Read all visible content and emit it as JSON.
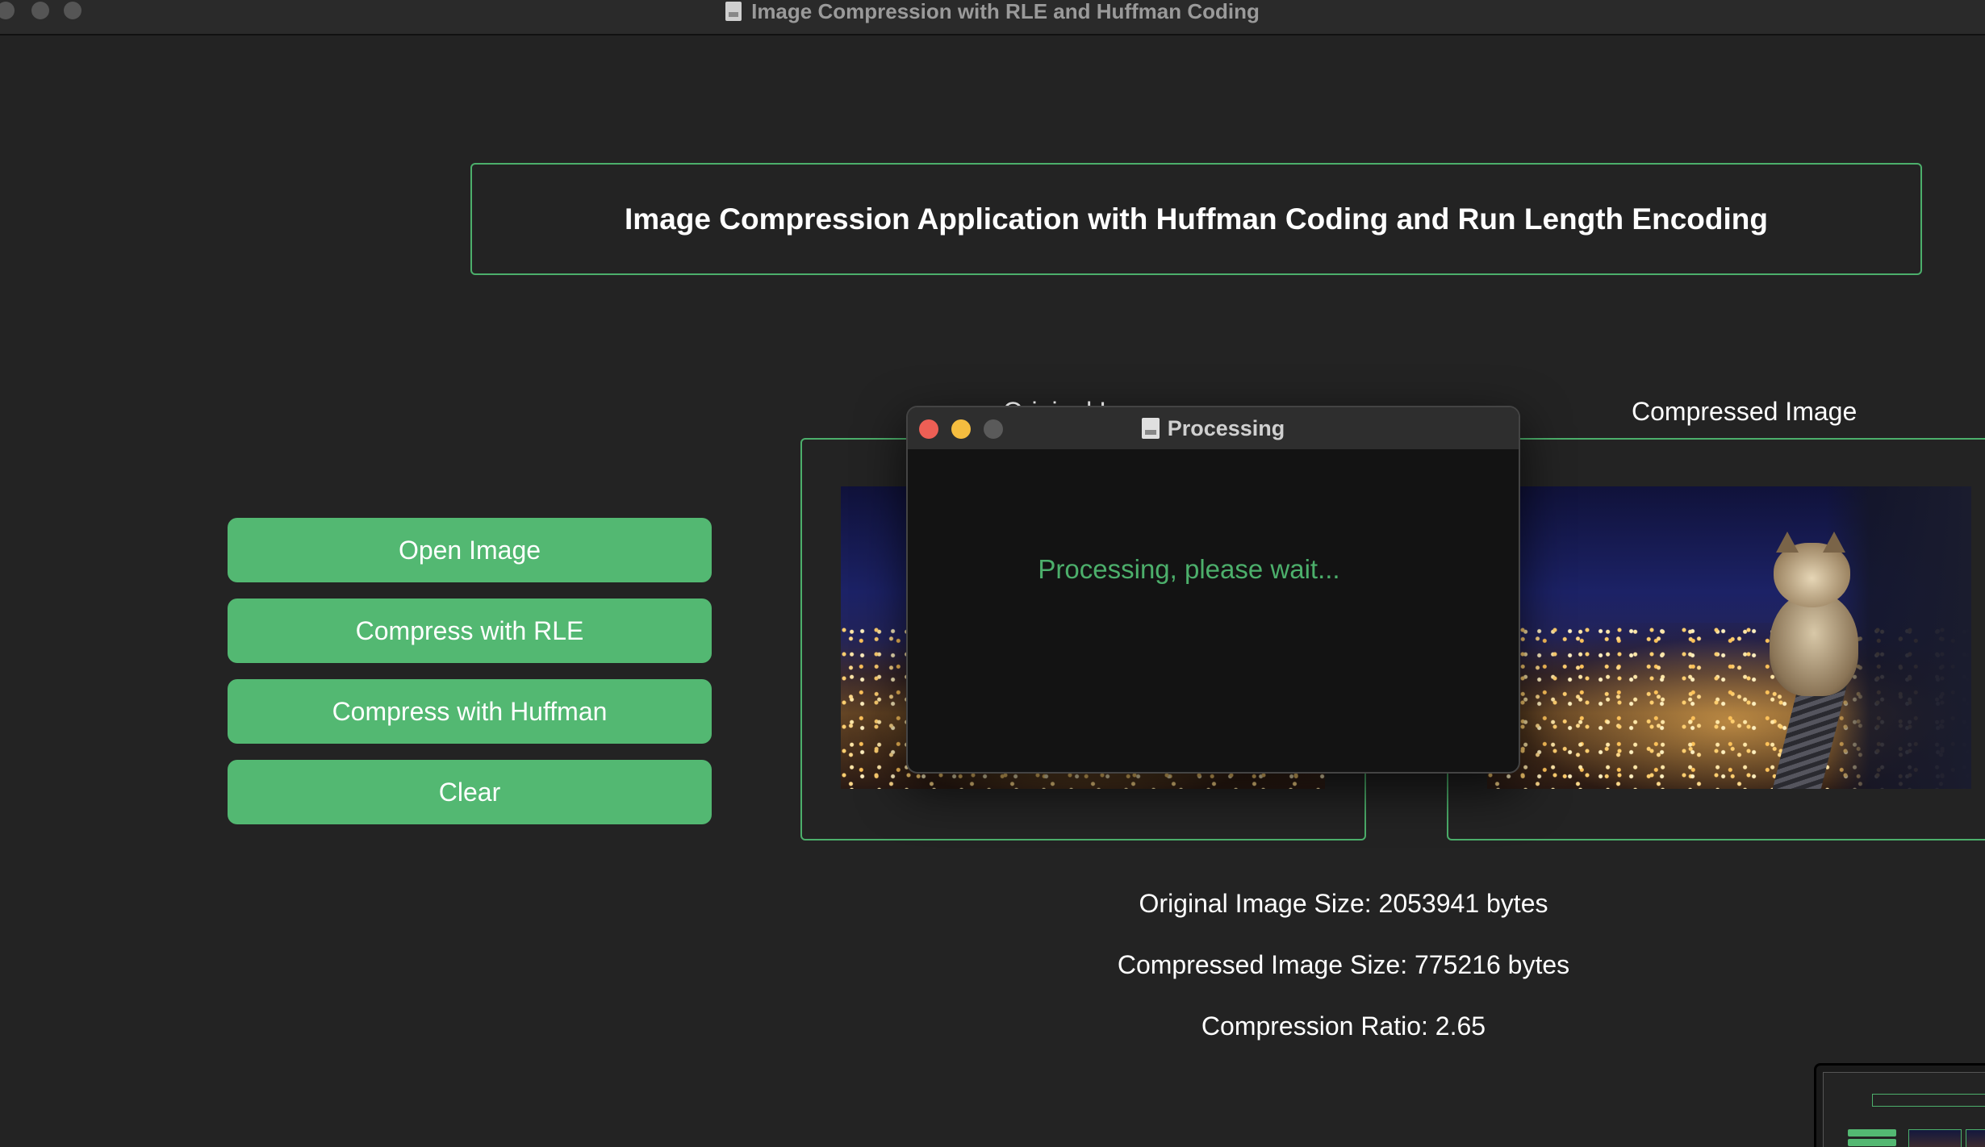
{
  "window": {
    "title": "Image Compression with RLE and Huffman Coding"
  },
  "header": {
    "text": "Image Compression Application with Huffman Coding and Run Length Encoding"
  },
  "buttons": {
    "open_image": "Open Image",
    "compress_rle": "Compress with RLE",
    "compress_huffman": "Compress with Huffman",
    "clear": "Clear"
  },
  "panels": {
    "original_label": "Original Image",
    "compressed_label": "Compressed Image"
  },
  "info": {
    "original_size": "Original Image Size: 2053941 bytes",
    "compressed_size": "Compressed Image Size: 775216 bytes",
    "ratio": "Compression Ratio: 2.65"
  },
  "dialog": {
    "title": "Processing",
    "message": "Processing, please wait..."
  },
  "colors": {
    "background": "#232323",
    "accent": "#53b872",
    "border_accent": "#4caf6b",
    "dialog_close": "#ed5f55",
    "dialog_minimize": "#f5bd3f",
    "dialog_zoom": "#5a5a5a"
  },
  "icons": {
    "titlebar_doc": "document-icon",
    "dialog_doc": "document-icon"
  }
}
